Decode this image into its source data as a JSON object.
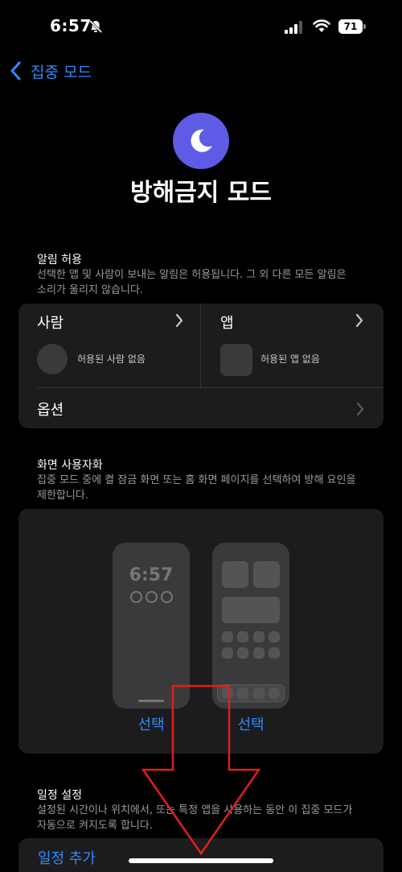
{
  "status": {
    "time": "6:57",
    "battery": "71"
  },
  "nav": {
    "back_label": "집중 모드"
  },
  "mode": {
    "title": "방해금지 모드",
    "icon": "moon-icon",
    "accent": "#5e5ce6"
  },
  "allow": {
    "title": "알림 허용",
    "desc": "선택한 앱 및 사람이 보내는 알림은 허용됩니다. 그 외 다른 모든 알림은 소리가 울리지 않습니다.",
    "people": {
      "label": "사람",
      "empty": "허용된 사람 없음"
    },
    "apps": {
      "label": "앱",
      "empty": "허용된 앱 없음"
    },
    "options_label": "옵션"
  },
  "screen": {
    "title": "화면 사용자화",
    "desc": "집중 모드 중에 켤 잠금 화면 또는 홈 화면 페이지를 선택하여 방해 요인을 제한합니다.",
    "lock_time": "6:57",
    "lock_select": "선택",
    "home_select": "선택"
  },
  "schedule": {
    "title": "일정 설정",
    "desc": "설정된 시간이나 위치에서, 또는 특정 앱을 사용하는 동안 이 집중 모드가 자동으로 켜지도록 합니다.",
    "add_label": "일정 추가"
  },
  "colors": {
    "link": "#2f8bff",
    "card": "#1c1c1e",
    "annotation_arrow": "#e0201a"
  }
}
